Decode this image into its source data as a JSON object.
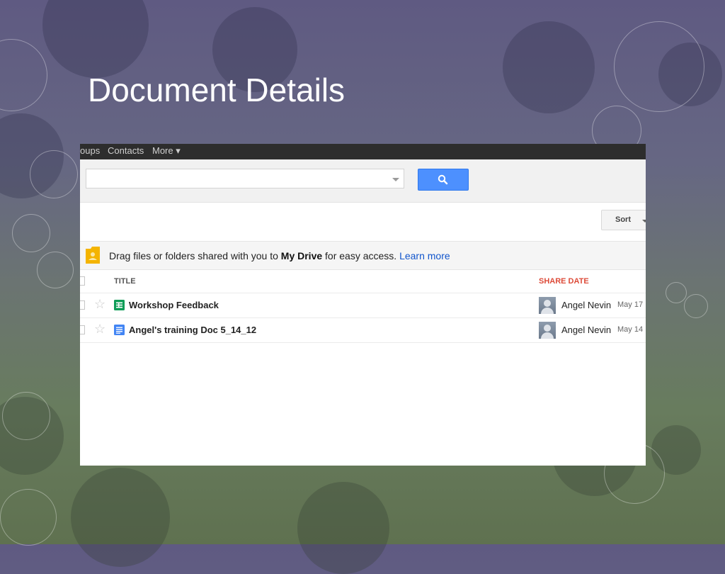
{
  "slide": {
    "title": "Document Details"
  },
  "topbar": {
    "items": [
      "oups",
      "Contacts",
      "More ▾"
    ]
  },
  "search": {
    "value": "",
    "placeholder": ""
  },
  "sort": {
    "label": "Sort"
  },
  "banner": {
    "text_before": "Drag files or folders shared with you to ",
    "bold": "My Drive",
    "text_after": " for easy access. ",
    "link": "Learn more"
  },
  "table": {
    "headers": {
      "title": "TITLE",
      "share_date": "SHARE DATE"
    },
    "rows": [
      {
        "name": "Workshop Feedback",
        "icon": "spreadsheet-icon",
        "owner": "Angel Nevin",
        "date": "May 17"
      },
      {
        "name": "Angel's training Doc 5_14_12",
        "icon": "document-icon",
        "owner": "Angel Nevin",
        "date": "May 14"
      }
    ]
  },
  "colors": {
    "search_button": "#4d90fe",
    "share_date_header": "#dd4b39",
    "link": "#1155cc",
    "spreadsheet": "#0f9d58",
    "document": "#4285f4",
    "folder": "#f4b400"
  }
}
